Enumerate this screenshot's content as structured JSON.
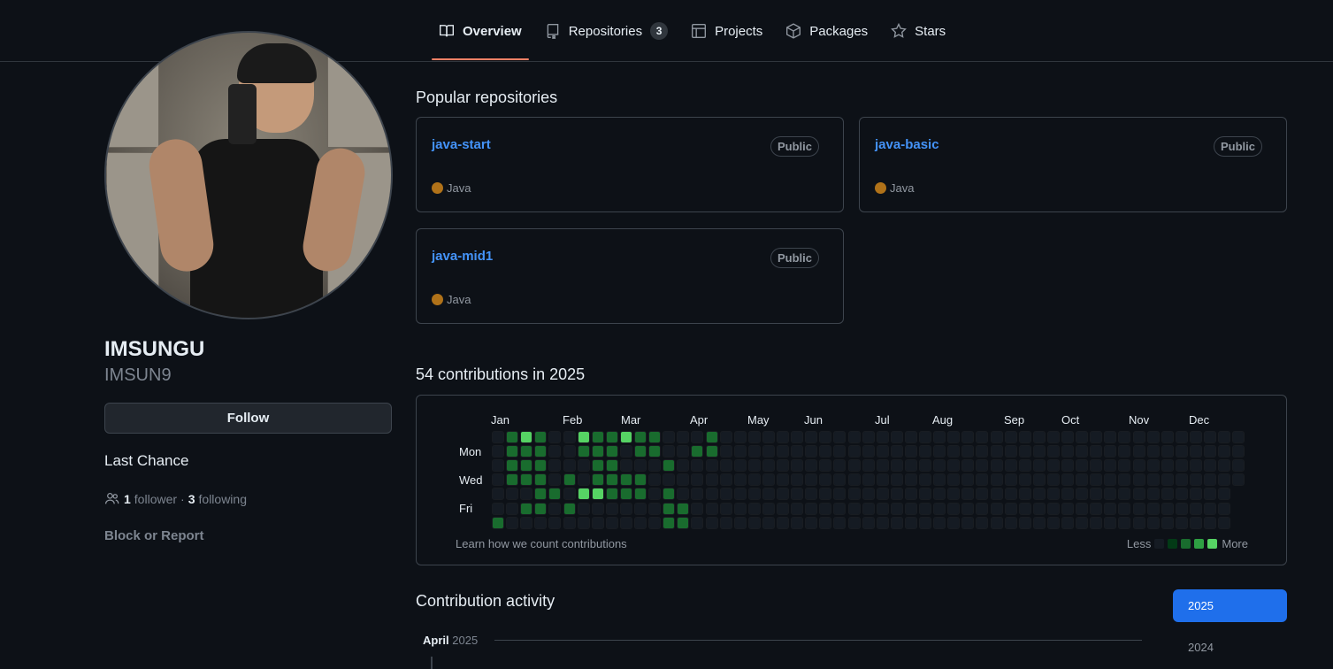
{
  "nav": {
    "tabs": [
      {
        "label": "Overview",
        "icon": "book-icon",
        "active": true
      },
      {
        "label": "Repositories",
        "icon": "repo-icon",
        "count": "3"
      },
      {
        "label": "Projects",
        "icon": "table-icon"
      },
      {
        "label": "Packages",
        "icon": "package-icon"
      },
      {
        "label": "Stars",
        "icon": "star-icon"
      }
    ]
  },
  "profile": {
    "full_name": "IMSUNGU",
    "login": "IMSUN9",
    "follow_label": "Follow",
    "bio": "Last Chance",
    "followers_count": "1",
    "followers_label": "follower",
    "separator": "·",
    "following_count": "3",
    "following_label": "following",
    "block_label": "Block or Report"
  },
  "popular": {
    "title": "Popular repositories",
    "repos": [
      {
        "name": "java-start",
        "visibility": "Public",
        "language": "Java",
        "language_color": "#b07219"
      },
      {
        "name": "java-basic",
        "visibility": "Public",
        "language": "Java",
        "language_color": "#b07219"
      },
      {
        "name": "java-mid1",
        "visibility": "Public",
        "language": "Java",
        "language_color": "#b07219"
      }
    ]
  },
  "contributions": {
    "title": "54 contributions in 2025",
    "months": [
      "Jan",
      "Feb",
      "Mar",
      "Apr",
      "May",
      "Jun",
      "Jul",
      "Aug",
      "Sep",
      "Oct",
      "Nov",
      "Dec"
    ],
    "day_labels": [
      "Mon",
      "Wed",
      "Fri"
    ],
    "learn_label": "Learn how we count contributions",
    "legend_less": "Less",
    "legend_more": "More",
    "level_colors": [
      "#151b23",
      "#033a16",
      "#196c2e",
      "#2ea043",
      "#56d364"
    ],
    "weeks": [
      [
        0,
        0,
        0,
        0,
        0,
        0,
        2
      ],
      [
        2,
        2,
        2,
        2,
        0,
        0,
        0
      ],
      [
        4,
        2,
        2,
        2,
        0,
        2,
        0
      ],
      [
        2,
        2,
        2,
        2,
        2,
        2,
        0
      ],
      [
        0,
        0,
        0,
        0,
        2,
        0,
        0
      ],
      [
        0,
        0,
        0,
        2,
        0,
        2,
        0
      ],
      [
        4,
        2,
        0,
        0,
        4,
        0,
        0
      ],
      [
        2,
        2,
        2,
        2,
        4,
        0,
        0
      ],
      [
        2,
        2,
        2,
        2,
        2,
        0,
        0
      ],
      [
        4,
        0,
        0,
        2,
        2,
        0,
        0
      ],
      [
        2,
        2,
        0,
        2,
        2,
        0,
        0
      ],
      [
        2,
        2,
        0,
        0,
        0,
        0,
        0
      ],
      [
        0,
        0,
        2,
        0,
        2,
        2,
        2
      ],
      [
        0,
        0,
        0,
        0,
        0,
        2,
        2
      ],
      [
        0,
        2,
        0,
        0,
        0,
        0,
        0
      ],
      [
        2,
        2,
        0,
        0,
        0,
        0,
        0
      ]
    ],
    "total_weeks": 53,
    "last_week_days": 4
  },
  "activity": {
    "title": "Contribution activity",
    "month_label": "April",
    "month_year": "2025",
    "years": [
      "2025",
      "2024"
    ]
  }
}
